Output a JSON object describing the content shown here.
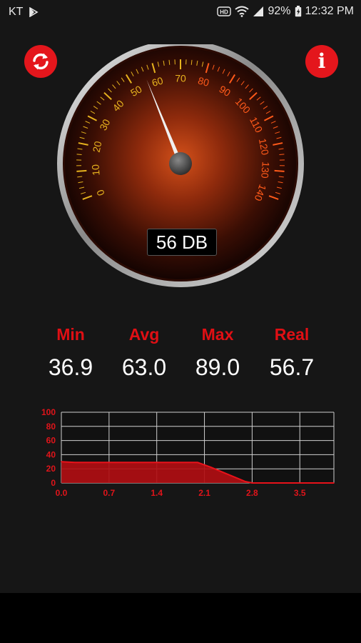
{
  "status_bar": {
    "carrier": "KT",
    "battery": "92%",
    "time": "12:32 PM",
    "icons": [
      "play-store-icon",
      "hd-icon",
      "wifi-icon",
      "signal-icon",
      "battery-icon"
    ]
  },
  "buttons": {
    "refresh_icon": "refresh-icon",
    "info_label": "i"
  },
  "gauge": {
    "scale_min": 0,
    "scale_max": 140,
    "labels": [
      "0",
      "10",
      "20",
      "30",
      "40",
      "50",
      "60",
      "70",
      "80",
      "90",
      "100",
      "110",
      "120",
      "130",
      "140"
    ],
    "needle_value": 56,
    "readout": "56 DB",
    "colors": {
      "face": "#b23a12",
      "accent": "#e11c14",
      "tick_low": "#e7b31e",
      "tick_high": "#ff5a1a"
    }
  },
  "stats": [
    {
      "label": "Min",
      "value": "36.9"
    },
    {
      "label": "Avg",
      "value": "63.0"
    },
    {
      "label": "Max",
      "value": "89.0"
    },
    {
      "label": "Real",
      "value": "56.7"
    }
  ],
  "chart_data": {
    "type": "area",
    "x": [
      0.0,
      0.2,
      0.4,
      0.6,
      0.8,
      1.0,
      1.2,
      1.4,
      1.6,
      1.8,
      2.0,
      2.2,
      2.4,
      2.6,
      2.7,
      2.8,
      3.0,
      3.2,
      3.4,
      3.6,
      3.8,
      4.0
    ],
    "series": [
      {
        "values": [
          30,
          29,
          29,
          29,
          29,
          29,
          29,
          29,
          29,
          29,
          29,
          22,
          14,
          6,
          2,
          0,
          0,
          0,
          0,
          0,
          0,
          0
        ]
      }
    ],
    "x_ticks": [
      "0.0",
      "0.7",
      "1.4",
      "2.1",
      "2.8",
      "3.5"
    ],
    "x_tick_values": [
      0.0,
      0.7,
      1.4,
      2.1,
      2.8,
      3.5
    ],
    "y_ticks": [
      "0",
      "20",
      "40",
      "60",
      "80",
      "100"
    ],
    "xlim": [
      0,
      4.0
    ],
    "ylim": [
      0,
      100
    ],
    "grid": true,
    "colors": {
      "fill": "#b00e12",
      "line": "#e8121a",
      "grid": "#cfcfcf",
      "tick_label": "#e0141a"
    }
  }
}
